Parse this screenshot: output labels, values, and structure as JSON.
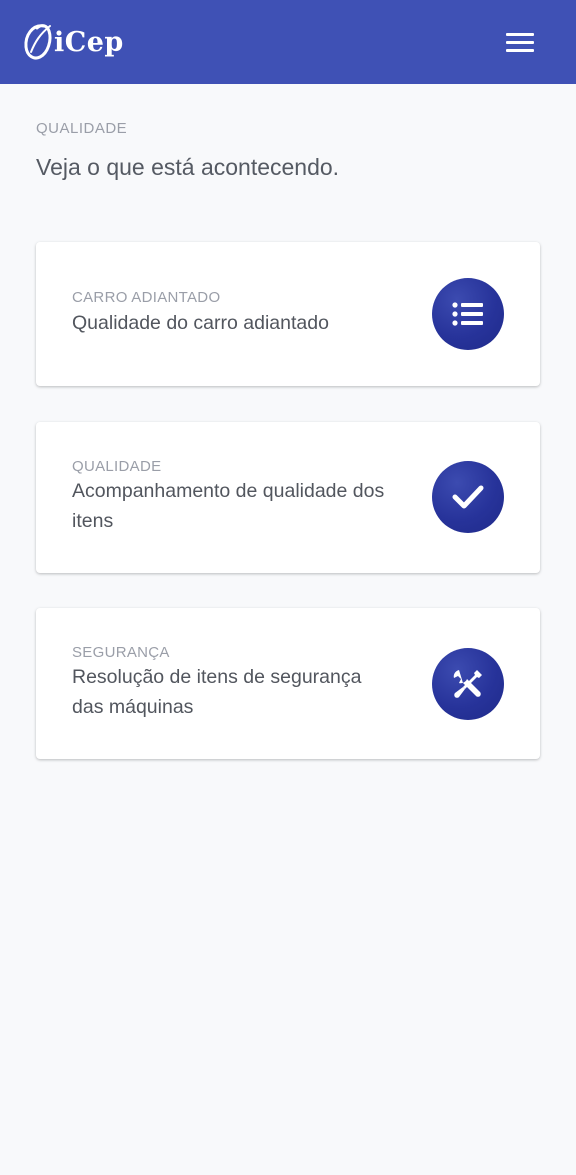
{
  "header": {
    "app_name": "iCep",
    "logo_icon": "swirl-o-logo",
    "menu_icon": "hamburger-menu-icon",
    "background_color": "#3f51b5"
  },
  "page": {
    "section_label": "QUALIDADE",
    "subtitle": "Veja o que está acontecendo."
  },
  "cards": [
    {
      "kicker": "CARRO ADIANTADO",
      "title": "Qualidade do carro adiantado",
      "icon": "list-icon"
    },
    {
      "kicker": "QUALIDADE",
      "title": "Acompanhamento de qualidade dos itens",
      "icon": "check-icon"
    },
    {
      "kicker": "SEGURANÇA",
      "title": "Resolução de itens de segurança das máquinas",
      "icon": "tools-icon"
    }
  ],
  "colors": {
    "accent": "#3f51b5",
    "icon_circle": "#27339a",
    "page_background": "#f8f9fb"
  }
}
